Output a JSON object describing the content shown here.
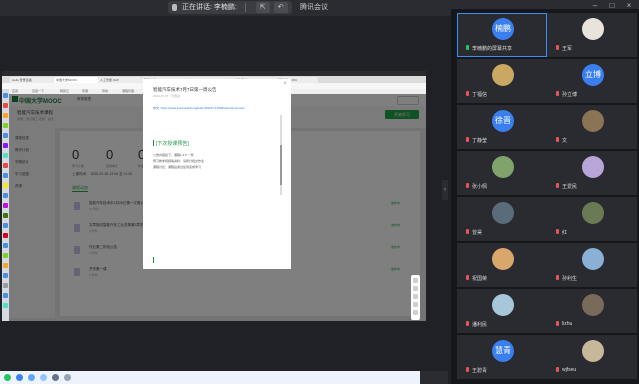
{
  "app": {
    "title": "腾讯会议"
  },
  "speaking": {
    "label": "正在讲话: 李楠鹏:"
  },
  "browser": {
    "address": "www.icourse163.org",
    "tabs": [
      "Hello 登录直播",
      "中国大学MOOC",
      "人工智能·SAP",
      "腾讯文档",
      "AUTOMOBILE",
      "大学生汽车",
      "中国大学MOOC"
    ],
    "bookmarks": [
      "应用",
      "百度一下",
      "网易云",
      "慕课",
      "导航",
      "课程管理"
    ]
  },
  "mooc": {
    "logo": "中国大学MOOC",
    "nav": "教育管理",
    "course_title": "智能汽车技术课程",
    "course_sub": "学校：武汉理工   老师：郑志",
    "learn_button": "开始学习",
    "sidebar": [
      "课程信息",
      "教学计划",
      "学期统计",
      "学习进度",
      "资源"
    ],
    "stats": {
      "nums": [
        "0",
        "0",
        "0",
        "0",
        "0"
      ],
      "labels": [
        "学习人数",
        "完成单元",
        "作业",
        "讨论",
        "测验"
      ]
    },
    "time_label": "上课时间： 2020-02-26 13:54 至 11:30",
    "section_label": "课程动态",
    "rows": [
      {
        "title": "智能汽车技术中2月26日第一次周公告",
        "sub": "10 附件",
        "tag": "发布中"
      },
      {
        "title": "文章指向智能汽车工业变革第3章学习",
        "sub": "5 附件",
        "tag": "发布中"
      },
      {
        "title": "作业第二阶段公告",
        "sub": "3 附件",
        "tag": "发布中"
      },
      {
        "title": "开学第一课",
        "sub": "8 附件",
        "tag": "发布中"
      }
    ]
  },
  "modal": {
    "title": "智能汽车技术7月7日第一周公告",
    "meta": "2020-07-07 · 已阅读",
    "url": "中文: https://www.icourse163.org/learn/WHUT-1450#/learn/announce",
    "heading": "[下次授课预告]",
    "lines": [
      "公告内容如下：课程1.3.5 一周",
      "预习教学视频等资料：请按分组交作业",
      "课程讨论：课程后通过签到完成学习"
    ],
    "close": "×"
  },
  "participants": [
    {
      "name": "李楠鹏的屏幕共享",
      "avatar_text": "楠鹏",
      "mic": "on"
    },
    {
      "name": "王军",
      "avatar_text": "",
      "mic": "off"
    },
    {
      "name": "丁福信",
      "avatar_text": "",
      "mic": "off"
    },
    {
      "name": "孙立博",
      "avatar_text": "立博",
      "mic": "off"
    },
    {
      "name": "丁静莹",
      "avatar_text": "徐晋",
      "mic": "off"
    },
    {
      "name": "文",
      "avatar_text": "",
      "mic": "off"
    },
    {
      "name": "张小佩",
      "avatar_text": "",
      "mic": "off"
    },
    {
      "name": "王爱民",
      "avatar_text": "",
      "mic": "off"
    },
    {
      "name": "曾昊",
      "avatar_text": "",
      "mic": "off"
    },
    {
      "name": "红",
      "avatar_text": "",
      "mic": "off"
    },
    {
      "name": "祝国荣",
      "avatar_text": "",
      "mic": "off"
    },
    {
      "name": "孙利生",
      "avatar_text": "",
      "mic": "off"
    },
    {
      "name": "潘利民",
      "avatar_text": "",
      "mic": "off"
    },
    {
      "name": "lizhu",
      "avatar_text": "",
      "mic": "off"
    },
    {
      "name": "王碧青",
      "avatar_text": "慧青",
      "mic": "off"
    },
    {
      "name": "wjfseu",
      "avatar_text": "",
      "mic": "off"
    }
  ]
}
